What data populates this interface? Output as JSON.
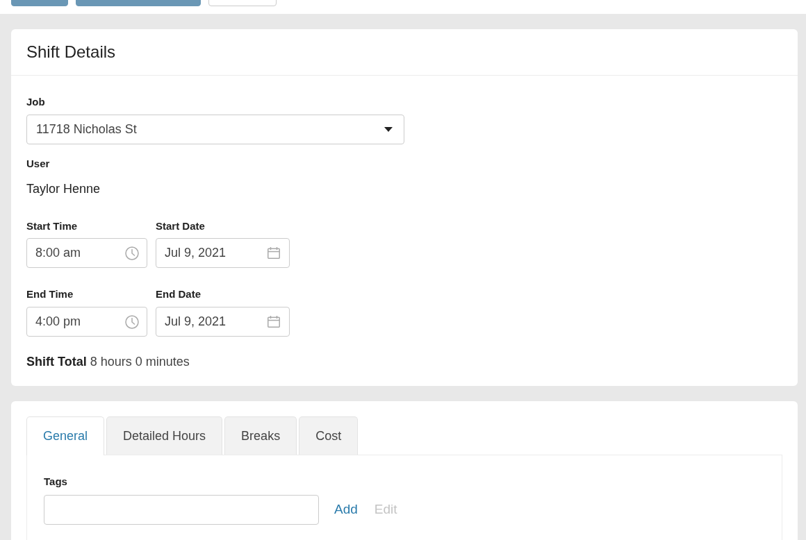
{
  "toolbar": {
    "buttons": [
      {
        "kind": "primary"
      },
      {
        "kind": "primary"
      },
      {
        "kind": "outline"
      }
    ]
  },
  "shift_details": {
    "title": "Shift Details",
    "job": {
      "label": "Job",
      "value": "11718 Nicholas St"
    },
    "user": {
      "label": "User",
      "value": "Taylor Henne"
    },
    "fields": [
      {
        "label": "Start Time",
        "value": "8:00 am",
        "kind": "time"
      },
      {
        "label": "Start Date",
        "value": "Jul 9, 2021",
        "kind": "date"
      },
      {
        "label": "End Time",
        "value": "4:00 pm",
        "kind": "time"
      },
      {
        "label": "End Date",
        "value": "Jul 9, 2021",
        "kind": "date"
      }
    ],
    "shift_total": {
      "label": "Shift Total",
      "value": "8 hours 0 minutes"
    }
  },
  "tabs": [
    {
      "label": "General",
      "selected": true
    },
    {
      "label": "Detailed Hours",
      "selected": false
    },
    {
      "label": "Breaks",
      "selected": false
    },
    {
      "label": "Cost",
      "selected": false
    }
  ],
  "tags": {
    "label": "Tags",
    "actions": [
      {
        "label": "Add",
        "disabled": false
      },
      {
        "label": "Edit",
        "disabled": true
      }
    ]
  }
}
